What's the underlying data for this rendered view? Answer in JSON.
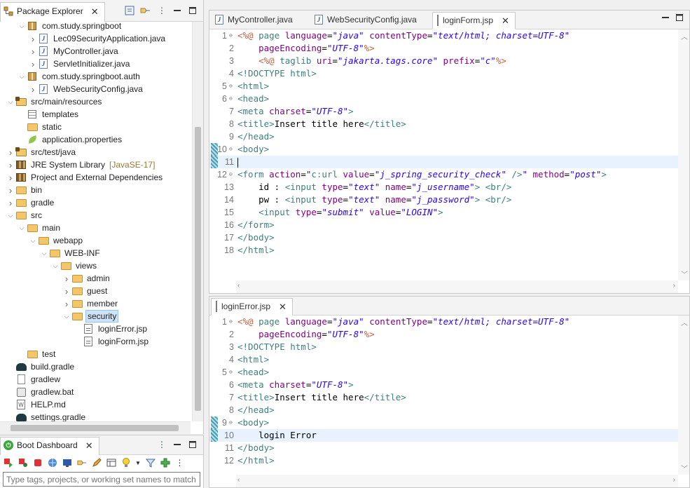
{
  "package_explorer": {
    "title": "Package Explorer",
    "tree": [
      {
        "label": "com.study.springboot",
        "icon": "package-icon",
        "expanded": true,
        "level": 2
      },
      {
        "label": "Lec09SecurityApplication.java",
        "icon": "java-file-icon",
        "expanded": false,
        "level": 3
      },
      {
        "label": "MyController.java",
        "icon": "java-file-icon",
        "expanded": false,
        "level": 3
      },
      {
        "label": "ServletInitializer.java",
        "icon": "java-file-icon",
        "expanded": false,
        "level": 3
      },
      {
        "label": "com.study.springboot.auth",
        "icon": "package-icon",
        "expanded": true,
        "level": 2
      },
      {
        "label": "WebSecurityConfig.java",
        "icon": "java-file-icon",
        "expanded": false,
        "level": 3
      },
      {
        "label": "src/main/resources",
        "icon": "source-folder-icon",
        "expanded": true,
        "level": 1
      },
      {
        "label": "templates",
        "icon": "templates-icon",
        "expanded": null,
        "level": 2
      },
      {
        "label": "static",
        "icon": "folder-icon",
        "expanded": null,
        "level": 2
      },
      {
        "label": "application.properties",
        "icon": "properties-icon",
        "expanded": null,
        "level": 2
      },
      {
        "label": "src/test/java",
        "icon": "source-folder-icon",
        "expanded": false,
        "level": 1
      },
      {
        "label": "JRE System Library",
        "suffix": "[JavaSE-17]",
        "icon": "library-icon",
        "expanded": false,
        "level": 1
      },
      {
        "label": "Project and External Dependencies",
        "icon": "library-icon",
        "expanded": false,
        "level": 1
      },
      {
        "label": "bin",
        "icon": "folder-icon",
        "expanded": false,
        "level": 1
      },
      {
        "label": "gradle",
        "icon": "folder-icon",
        "expanded": false,
        "level": 1
      },
      {
        "label": "src",
        "icon": "folder-icon",
        "expanded": true,
        "level": 1
      },
      {
        "label": "main",
        "icon": "folder-icon",
        "expanded": true,
        "level": 2
      },
      {
        "label": "webapp",
        "icon": "folder-icon",
        "expanded": true,
        "level": 3
      },
      {
        "label": "WEB-INF",
        "icon": "folder-icon",
        "expanded": true,
        "level": 4
      },
      {
        "label": "views",
        "icon": "folder-icon",
        "expanded": true,
        "level": 5
      },
      {
        "label": "admin",
        "icon": "folder-icon",
        "expanded": false,
        "level": 6
      },
      {
        "label": "guest",
        "icon": "folder-icon",
        "expanded": false,
        "level": 6
      },
      {
        "label": "member",
        "icon": "folder-icon",
        "expanded": false,
        "level": 6
      },
      {
        "label": "security",
        "icon": "folder-icon",
        "expanded": true,
        "level": 6,
        "selected": true
      },
      {
        "label": "loginError.jsp",
        "icon": "jsp-file-icon",
        "expanded": null,
        "level": 7
      },
      {
        "label": "loginForm.jsp",
        "icon": "jsp-file-icon",
        "expanded": null,
        "level": 7
      },
      {
        "label": "test",
        "icon": "folder-icon",
        "expanded": null,
        "level": 2
      },
      {
        "label": "build.gradle",
        "icon": "gradle-icon",
        "expanded": null,
        "level": 1
      },
      {
        "label": "gradlew",
        "icon": "file-icon",
        "expanded": null,
        "level": 1
      },
      {
        "label": "gradlew.bat",
        "icon": "bat-file-icon",
        "expanded": null,
        "level": 1
      },
      {
        "label": "HELP.md",
        "icon": "md-file-icon",
        "expanded": null,
        "level": 1
      },
      {
        "label": "settings.gradle",
        "icon": "gradle-icon",
        "expanded": null,
        "level": 1
      }
    ]
  },
  "boot_dashboard": {
    "title": "Boot Dashboard",
    "filter_placeholder": "Type tags, projects, or working set names to match"
  },
  "editor_top": {
    "tabs": [
      {
        "label": "MyController.java",
        "icon": "java-file-icon",
        "active": false
      },
      {
        "label": "WebSecurityConfig.java",
        "icon": "java-file-icon",
        "active": false
      },
      {
        "label": "loginForm.jsp",
        "icon": "jsp-file-icon",
        "active": true
      }
    ],
    "current_line": 11,
    "lines": [
      {
        "n": "1",
        "fold": "⊖",
        "tokens": [
          [
            "d",
            "<%@ "
          ],
          [
            "k",
            "page "
          ],
          [
            "a",
            "language"
          ],
          [
            "t",
            "="
          ],
          [
            "v",
            "\"java\""
          ],
          [
            "t",
            " "
          ],
          [
            "a",
            "contentType"
          ],
          [
            "t",
            "="
          ],
          [
            "v",
            "\"text/html; charset=UTF-8\""
          ]
        ]
      },
      {
        "n": "2",
        "tokens": [
          [
            "t",
            "    "
          ],
          [
            "a",
            "pageEncoding"
          ],
          [
            "t",
            "="
          ],
          [
            "v",
            "\"UTF-8\""
          ],
          [
            "d",
            "%>"
          ]
        ]
      },
      {
        "n": "3",
        "tokens": [
          [
            "t",
            "    "
          ],
          [
            "d",
            "<%@ "
          ],
          [
            "k",
            "taglib "
          ],
          [
            "a",
            "uri"
          ],
          [
            "t",
            "="
          ],
          [
            "v",
            "\"jakarta.tags.core\""
          ],
          [
            "t",
            " "
          ],
          [
            "a",
            "prefix"
          ],
          [
            "t",
            "="
          ],
          [
            "v",
            "\"c\""
          ],
          [
            "d",
            "%>"
          ]
        ]
      },
      {
        "n": "4",
        "tokens": [
          [
            "k",
            "<!DOCTYPE html>"
          ]
        ]
      },
      {
        "n": "5",
        "fold": "⊖",
        "tokens": [
          [
            "k",
            "<html>"
          ]
        ]
      },
      {
        "n": "6",
        "fold": "⊖",
        "tokens": [
          [
            "k",
            "<head>"
          ]
        ]
      },
      {
        "n": "7",
        "tokens": [
          [
            "k",
            "<meta "
          ],
          [
            "a",
            "charset"
          ],
          [
            "t",
            "="
          ],
          [
            "v",
            "\"UTF-8\""
          ],
          [
            "k",
            ">"
          ]
        ]
      },
      {
        "n": "8",
        "tokens": [
          [
            "k",
            "<title>"
          ],
          [
            "t",
            "Insert title here"
          ],
          [
            "k",
            "</title>"
          ]
        ]
      },
      {
        "n": "9",
        "tokens": [
          [
            "k",
            "</head>"
          ]
        ]
      },
      {
        "n": "10",
        "fold": "⊖",
        "marker": true,
        "tokens": [
          [
            "k",
            "<body>"
          ]
        ]
      },
      {
        "n": "11",
        "marker": true,
        "caret": true,
        "tokens": []
      },
      {
        "n": "12",
        "fold": "⊖",
        "tokens": [
          [
            "k",
            "<form "
          ],
          [
            "a",
            "action"
          ],
          [
            "t",
            "="
          ],
          [
            "v",
            "\""
          ],
          [
            "k",
            "c:url "
          ],
          [
            "a",
            "value"
          ],
          [
            "t",
            "="
          ],
          [
            "v",
            "\"j_spring_security_check\""
          ],
          [
            "t",
            " "
          ],
          [
            "k",
            "/>"
          ],
          [
            "v",
            "\""
          ],
          [
            "t",
            " "
          ],
          [
            "a",
            "method"
          ],
          [
            "t",
            "="
          ],
          [
            "v",
            "\"post\""
          ],
          [
            "k",
            ">"
          ]
        ]
      },
      {
        "n": "13",
        "tokens": [
          [
            "t",
            "    id : "
          ],
          [
            "k",
            "<input "
          ],
          [
            "a",
            "type"
          ],
          [
            "t",
            "="
          ],
          [
            "v",
            "\"text\""
          ],
          [
            "t",
            " "
          ],
          [
            "a",
            "name"
          ],
          [
            "t",
            "="
          ],
          [
            "v",
            "\"j_username\""
          ],
          [
            "k",
            "> <br/>"
          ]
        ]
      },
      {
        "n": "14",
        "tokens": [
          [
            "t",
            "    pw : "
          ],
          [
            "k",
            "<input "
          ],
          [
            "a",
            "type"
          ],
          [
            "t",
            "="
          ],
          [
            "v",
            "\"text\""
          ],
          [
            "t",
            " "
          ],
          [
            "a",
            "name"
          ],
          [
            "t",
            "="
          ],
          [
            "v",
            "\"j_password\""
          ],
          [
            "k",
            "> <br/>"
          ]
        ]
      },
      {
        "n": "15",
        "tokens": [
          [
            "t",
            "    "
          ],
          [
            "k",
            "<input "
          ],
          [
            "a",
            "type"
          ],
          [
            "t",
            "="
          ],
          [
            "v",
            "\"submit\""
          ],
          [
            "t",
            " "
          ],
          [
            "a",
            "value"
          ],
          [
            "t",
            "="
          ],
          [
            "v",
            "\"LOGIN\""
          ],
          [
            "k",
            ">"
          ]
        ]
      },
      {
        "n": "16",
        "tokens": [
          [
            "k",
            "</form>"
          ]
        ]
      },
      {
        "n": "17",
        "tokens": [
          [
            "k",
            "</body>"
          ]
        ]
      },
      {
        "n": "18",
        "tokens": [
          [
            "k",
            "</html>"
          ]
        ]
      }
    ]
  },
  "editor_bottom": {
    "tabs": [
      {
        "label": "loginError.jsp",
        "icon": "jsp-file-icon",
        "active": true
      }
    ],
    "current_line": 10,
    "lines": [
      {
        "n": "1",
        "fold": "⊖",
        "tokens": [
          [
            "d",
            "<%@ "
          ],
          [
            "k",
            "page "
          ],
          [
            "a",
            "language"
          ],
          [
            "t",
            "="
          ],
          [
            "v",
            "\"java\""
          ],
          [
            "t",
            " "
          ],
          [
            "a",
            "contentType"
          ],
          [
            "t",
            "="
          ],
          [
            "v",
            "\"text/html; charset=UTF-8\""
          ]
        ]
      },
      {
        "n": "2",
        "tokens": [
          [
            "t",
            "    "
          ],
          [
            "a",
            "pageEncoding"
          ],
          [
            "t",
            "="
          ],
          [
            "v",
            "\"UTF-8\""
          ],
          [
            "d",
            "%>"
          ]
        ]
      },
      {
        "n": "3",
        "tokens": [
          [
            "k",
            "<!DOCTYPE html>"
          ]
        ]
      },
      {
        "n": "4",
        "tokens": [
          [
            "k",
            "<html>"
          ]
        ]
      },
      {
        "n": "5",
        "fold": "⊖",
        "tokens": [
          [
            "k",
            "<head>"
          ]
        ]
      },
      {
        "n": "6",
        "tokens": [
          [
            "k",
            "<meta "
          ],
          [
            "a",
            "charset"
          ],
          [
            "t",
            "="
          ],
          [
            "v",
            "\"UTF-8\""
          ],
          [
            "k",
            ">"
          ]
        ]
      },
      {
        "n": "7",
        "tokens": [
          [
            "k",
            "<title>"
          ],
          [
            "t",
            "Insert title here"
          ],
          [
            "k",
            "</title>"
          ]
        ]
      },
      {
        "n": "8",
        "tokens": [
          [
            "k",
            "</head>"
          ]
        ]
      },
      {
        "n": "9",
        "fold": "⊖",
        "marker": true,
        "tokens": [
          [
            "k",
            "<body>"
          ]
        ]
      },
      {
        "n": "10",
        "marker": true,
        "tokens": [
          [
            "t",
            "    login Error"
          ]
        ]
      },
      {
        "n": "11",
        "tokens": [
          [
            "k",
            "</body>"
          ]
        ]
      },
      {
        "n": "12",
        "tokens": [
          [
            "k",
            "</html>"
          ]
        ]
      }
    ]
  }
}
